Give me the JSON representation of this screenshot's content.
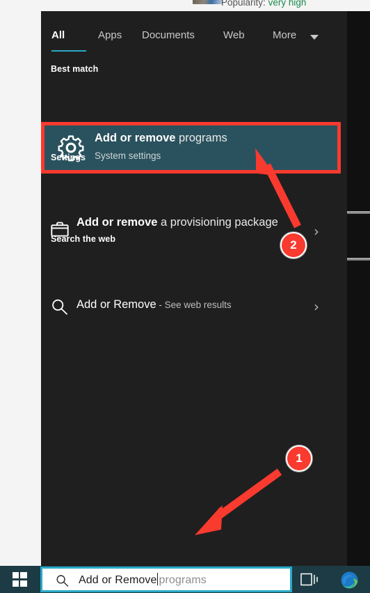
{
  "background": {
    "popularity_label": "Popularity:",
    "popularity_value": "very high"
  },
  "start_menu": {
    "tabs": [
      {
        "label": "All",
        "active": true
      },
      {
        "label": "Apps",
        "active": false
      },
      {
        "label": "Documents",
        "active": false
      },
      {
        "label": "Web",
        "active": false
      },
      {
        "label": "More",
        "active": false
      }
    ],
    "sections": {
      "best_match": {
        "heading": "Best match",
        "item": {
          "title_bold": "Add or remove",
          "title_normal": " programs",
          "subtitle": "System settings",
          "icon": "gear-icon",
          "highlight_color": "#2a525e",
          "outline_color": "#f93a2f"
        }
      },
      "settings": {
        "heading": "Settings",
        "item": {
          "title_bold": "Add or remove",
          "title_normal": " a provisioning package",
          "icon": "briefcase-icon",
          "chevron": "›"
        }
      },
      "search_the_web": {
        "heading": "Search the web",
        "item": {
          "query": "Add or Remove",
          "suffix": " - See web results",
          "icon": "search-icon",
          "chevron": "›"
        }
      }
    }
  },
  "annotations": {
    "badges": [
      {
        "label": "1",
        "color": "#f93a2f"
      },
      {
        "label": "2",
        "color": "#f93a2f"
      }
    ],
    "arrow_color": "#f93a2f"
  },
  "taskbar": {
    "start_button": "start-button",
    "search": {
      "typed_value": "Add or Remove",
      "suggestion_suffix": "programs",
      "icon": "search-icon",
      "border_color": "#29a8c8"
    },
    "task_view": "Task View",
    "edge": "Microsoft Edge"
  }
}
